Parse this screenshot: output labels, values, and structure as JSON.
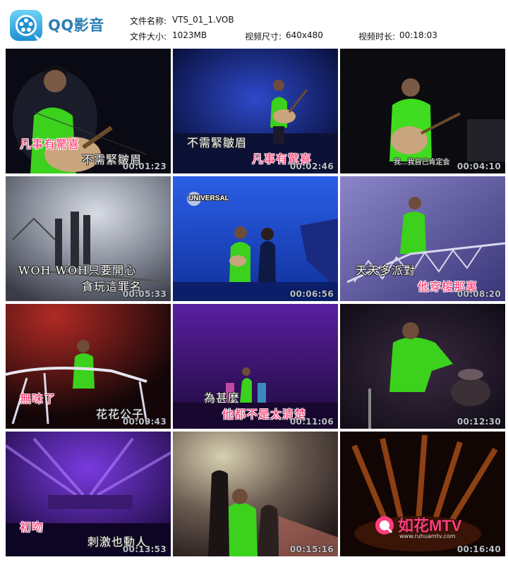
{
  "app": {
    "name": "QQ影音"
  },
  "file": {
    "name_label": "文件名称:",
    "name_value": "VTS_01_1.VOB",
    "size_label": "文件大小:",
    "size_value": "1023MB",
    "dim_label": "视频尺寸:",
    "dim_value": "640x480",
    "duration_label": "视频时长:",
    "duration_value": "00:18:03"
  },
  "thumbnails": [
    {
      "time": "00:01:23",
      "captions": [
        "凡事有驚喜",
        "不需緊皺眉"
      ]
    },
    {
      "time": "00:02:46",
      "captions": [
        "不需緊皺眉",
        "凡事有驚喜"
      ]
    },
    {
      "time": "00:04:10",
      "captions": [
        "我...我自己肯定会"
      ]
    },
    {
      "time": "00:05:33",
      "captions": [
        "WOH WOH只要開心",
        "貪玩這罪名"
      ]
    },
    {
      "time": "00:06:56",
      "captions": [
        "UNIVERSAL"
      ]
    },
    {
      "time": "00:08:20",
      "captions": [
        "天天多派對",
        "他穿梭那裏"
      ]
    },
    {
      "time": "00:09:43",
      "captions": [
        "無味了",
        "花花公子"
      ]
    },
    {
      "time": "00:11:06",
      "captions": [
        "為甚麼",
        "他都不是太清楚"
      ]
    },
    {
      "time": "00:12:30",
      "captions": []
    },
    {
      "time": "00:13:53",
      "captions": [
        "初吻",
        "刺激也動人"
      ]
    },
    {
      "time": "00:15:16",
      "captions": []
    },
    {
      "time": "00:16:40",
      "captions": []
    }
  ],
  "watermark": {
    "text": "如花MTV",
    "url": "www.ruhuamtv.com"
  },
  "colors": {
    "brand": "#2b7fb3",
    "caption_pink": "#ff2a6a",
    "timestamp": "#b9c0c7"
  }
}
